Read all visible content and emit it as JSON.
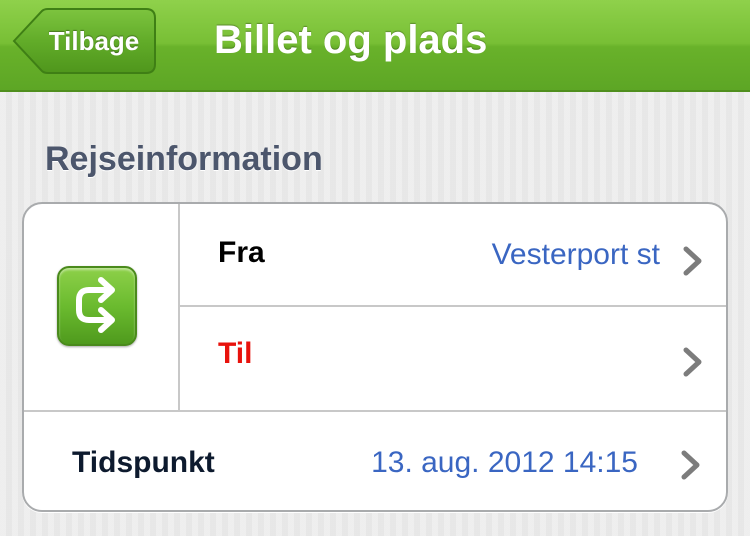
{
  "navbar": {
    "back_label": "Tilbage",
    "title": "Billet og plads"
  },
  "section": {
    "title": "Rejseinformation"
  },
  "journey": {
    "swap_icon": "swap-route-icon",
    "from": {
      "label": "Fra",
      "value": "Vesterport st"
    },
    "to": {
      "label": "Til",
      "value": ""
    },
    "time": {
      "label": "Tidspunkt",
      "value": "13. aug. 2012 14:15"
    }
  },
  "colors": {
    "navbar_green": "#6bb82e",
    "value_blue": "#3a66c2",
    "to_label_red": "#e8120c",
    "label_dark": "#000000",
    "section_text": "#4c566c"
  }
}
